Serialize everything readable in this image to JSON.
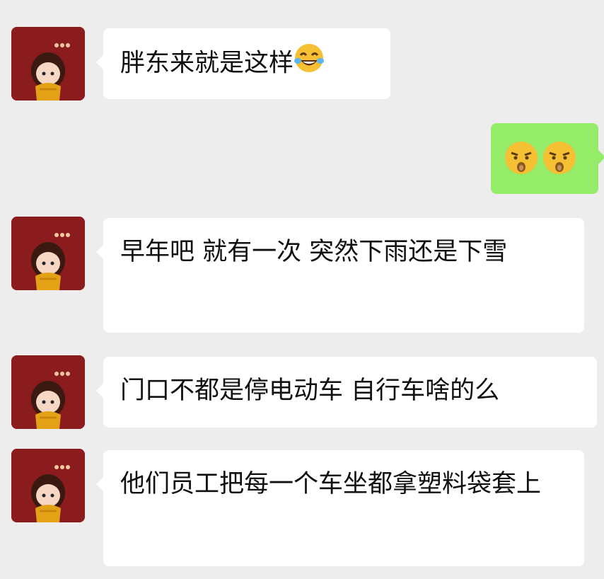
{
  "chat": {
    "messages": [
      {
        "sender": "other",
        "text": "胖东来就是这样",
        "emoji": "laughing-tears-icon"
      },
      {
        "sender": "self",
        "emoji": [
          "smirk-face-icon",
          "smirk-face-icon"
        ]
      },
      {
        "sender": "other",
        "text": "早年吧 就有一次 突然下雨还是下雪"
      },
      {
        "sender": "other",
        "text": "门口不都是停电动车 自行车啥的么"
      },
      {
        "sender": "other",
        "text": "他们员工把每一个车坐都拿塑料袋套上"
      }
    ]
  },
  "colors": {
    "background": "#ededed",
    "bubble_other": "#ffffff",
    "bubble_self": "#95ec69",
    "avatar_bg": "#8b1c1e"
  }
}
